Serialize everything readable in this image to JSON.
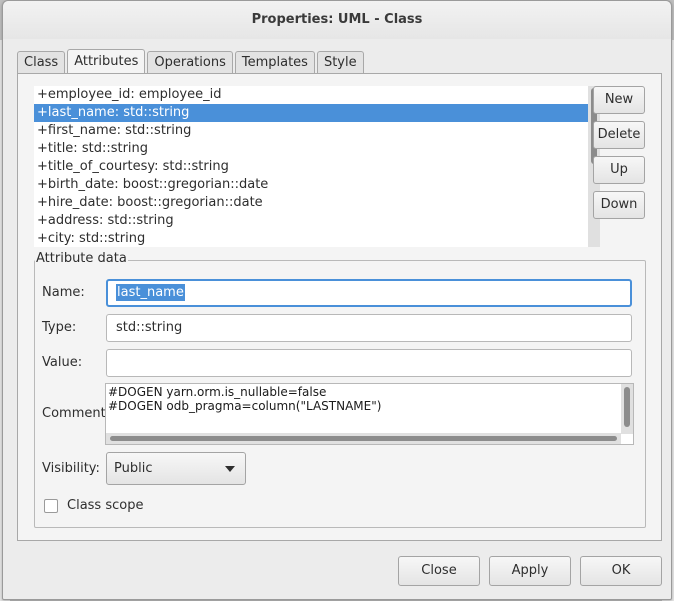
{
  "window": {
    "title": "Properties: UML - Class"
  },
  "tabs": [
    {
      "label": "Class"
    },
    {
      "label": "Attributes",
      "active": true
    },
    {
      "label": "Operations"
    },
    {
      "label": "Templates"
    },
    {
      "label": "Style"
    }
  ],
  "attributes": [
    {
      "text": "+employee_id: employee_id"
    },
    {
      "text": "+last_name: std::string",
      "selected": true
    },
    {
      "text": "+first_name: std::string"
    },
    {
      "text": "+title: std::string"
    },
    {
      "text": "+title_of_courtesy: std::string"
    },
    {
      "text": "+birth_date: boost::gregorian::date"
    },
    {
      "text": "+hire_date: boost::gregorian::date"
    },
    {
      "text": "+address: std::string"
    },
    {
      "text": "+city: std::string"
    }
  ],
  "list_buttons": {
    "new": "New",
    "delete": "Delete",
    "up": "Up",
    "down": "Down"
  },
  "attribute_data": {
    "legend": "Attribute data",
    "name_label": "Name:",
    "name_value": "last_name",
    "type_label": "Type:",
    "type_value": "std::string",
    "value_label": "Value:",
    "value_value": "",
    "comment_label": "Comment:",
    "comment_lines": [
      "#DOGEN yarn.orm.is_nullable=false",
      "#DOGEN odb_pragma=column(\"LASTNAME\")"
    ],
    "visibility_label": "Visibility:",
    "visibility_value": "Public",
    "class_scope_label": "Class scope",
    "class_scope_checked": false
  },
  "dialog_buttons": {
    "close": "Close",
    "apply": "Apply",
    "ok": "OK"
  },
  "icons": {
    "dropdown": "chevron-down-icon"
  },
  "colors": {
    "selection": "#4a90d9",
    "dialog_bg": "#ececec",
    "panel_bg": "#f4f4f4"
  }
}
